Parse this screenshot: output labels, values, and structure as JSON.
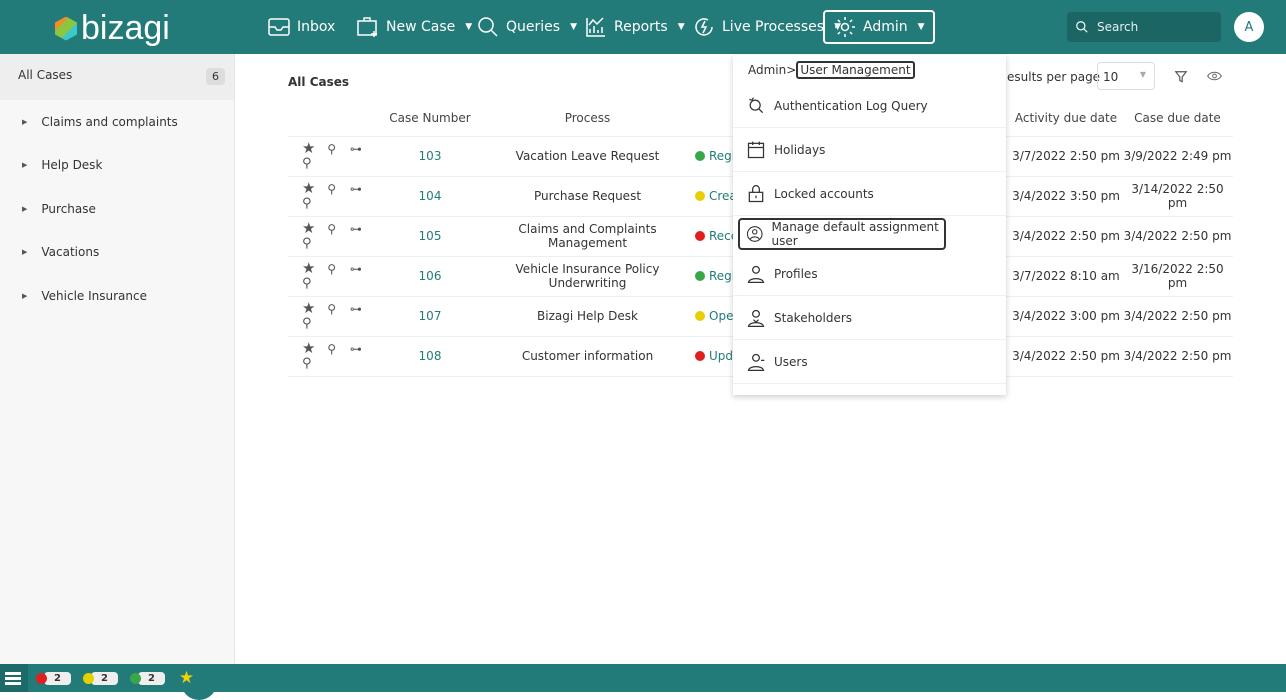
{
  "header": {
    "brand": "bizagi",
    "nav": [
      {
        "label": "Inbox",
        "icon": "inbox-icon"
      },
      {
        "label": "New Case",
        "icon": "new-case-icon"
      },
      {
        "label": "Queries",
        "icon": "search-icon"
      },
      {
        "label": "Reports",
        "icon": "reports-icon"
      },
      {
        "label": "Live Processes",
        "icon": "live-processes-icon"
      },
      {
        "label": "Admin",
        "icon": "gear-icon"
      }
    ],
    "search_placeholder": "Search",
    "avatar": "A"
  },
  "sidebar": {
    "all_cases": "All Cases",
    "count": "6",
    "items": [
      "Claims and complaints",
      "Help Desk",
      "Purchase",
      "Vacations",
      "Vehicle Insurance"
    ]
  },
  "main": {
    "title": "All Cases",
    "results_label": "esults per page",
    "results_value": "10",
    "columns": [
      "",
      "Case Number",
      "Process",
      "",
      "Activity due date",
      "Case due date"
    ],
    "rows": [
      {
        "num": "103",
        "process": "Vacation Leave Request",
        "status": "Regis",
        "color": "#3aa64a",
        "act": "3/7/2022 2:50 pm",
        "due": "3/9/2022 2:49 pm"
      },
      {
        "num": "104",
        "process": "Purchase Request",
        "status": "Crea",
        "color": "#e6d000",
        "act": "3/4/2022 3:50 pm",
        "due": "3/14/2022 2:50 pm"
      },
      {
        "num": "105",
        "process": "Claims and Complaints Management",
        "status": "Rece",
        "color": "#e02020",
        "act": "3/4/2022 2:50 pm",
        "due": "3/4/2022 2:50 pm"
      },
      {
        "num": "106",
        "process": "Vehicle Insurance Policy Underwriting",
        "status": "Regis",
        "color": "#3aa64a",
        "act": "3/7/2022 8:10 am",
        "due": "3/16/2022 2:50 pm"
      },
      {
        "num": "107",
        "process": "Bizagi Help Desk",
        "status": "Open",
        "color": "#e6d000",
        "act": "3/4/2022 3:00 pm",
        "due": "3/4/2022 2:50 pm"
      },
      {
        "num": "108",
        "process": "Customer information",
        "status": "Upda",
        "color": "#e02020",
        "act": "3/4/2022 2:50 pm",
        "due": "3/4/2022 2:50 pm"
      }
    ]
  },
  "admin_menu": {
    "breadcrumb_root": "Admin>",
    "breadcrumb_current": "User Management",
    "items": [
      "Authentication Log Query",
      "Holidays",
      "Locked accounts",
      "Manage default assignment user",
      "Profiles",
      "Stakeholders",
      "Users"
    ],
    "selected": "Manage default assignment user"
  },
  "footer": {
    "badges": [
      {
        "color": "#e02020",
        "count": "2"
      },
      {
        "color": "#e6d000",
        "count": "2"
      },
      {
        "color": "#3aa64a",
        "count": "2"
      }
    ]
  },
  "colors": {
    "brand": "#227b79"
  }
}
